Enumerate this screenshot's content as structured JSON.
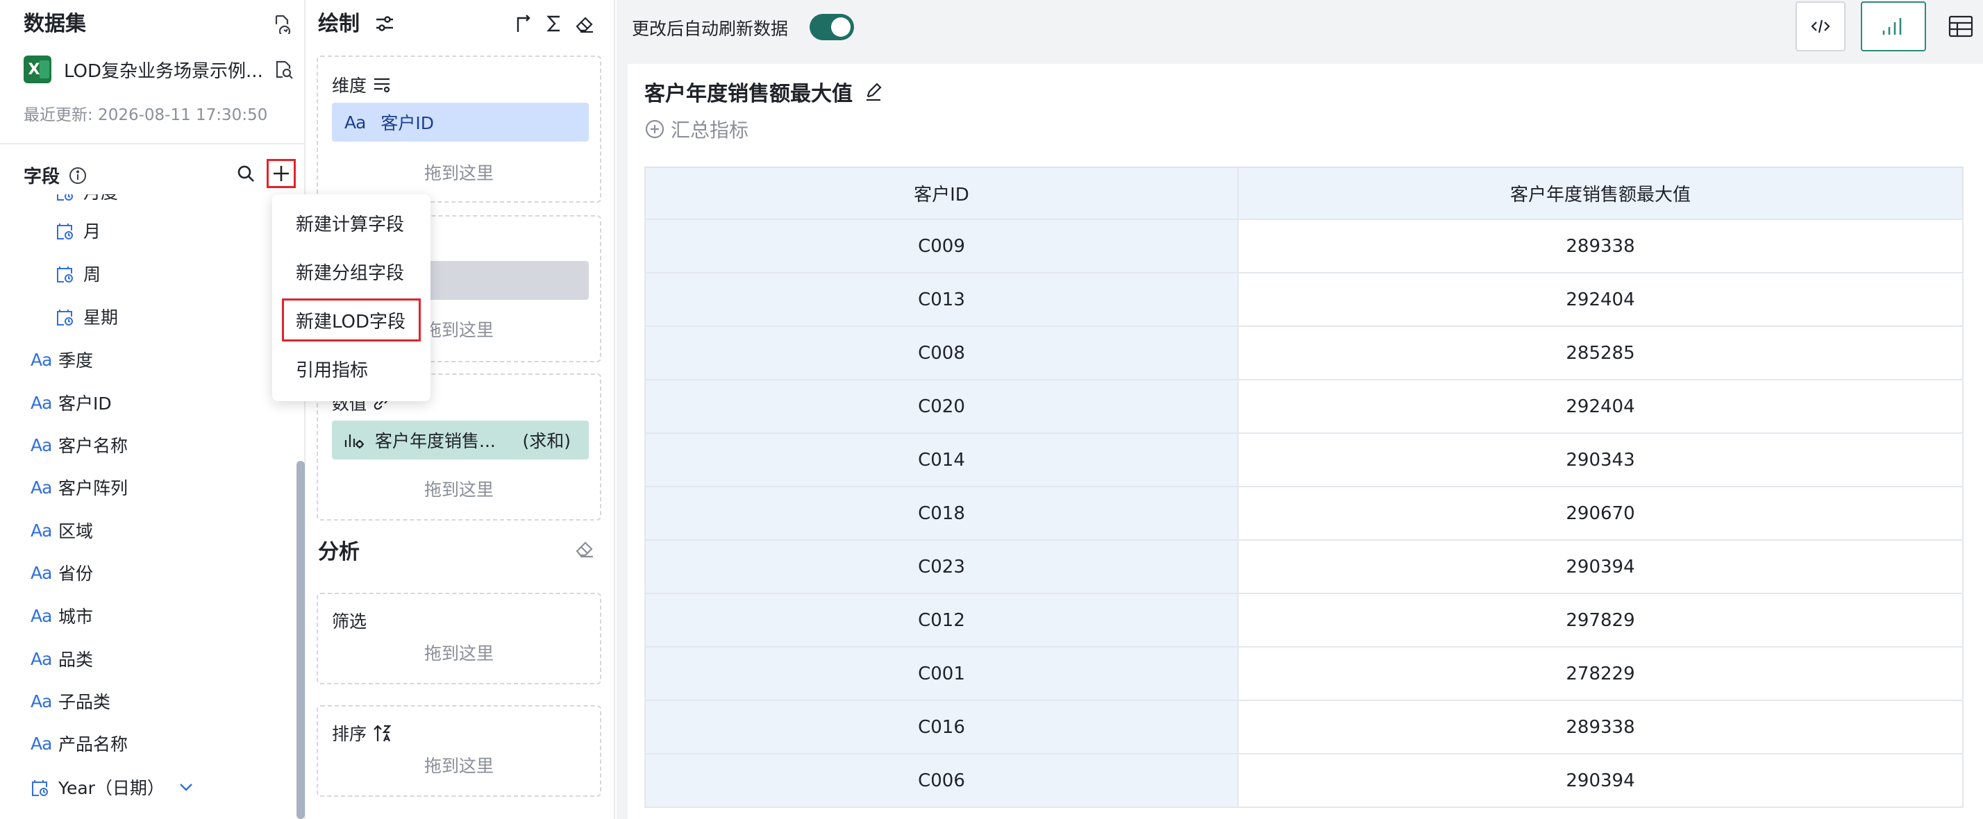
{
  "dataset": {
    "title": "数据集",
    "file_name": "LOD复杂业务场景示例...",
    "last_updated": "最近更新: 2026-08-11 17:30:50"
  },
  "fields": {
    "title": "字段",
    "items": [
      {
        "type": "date",
        "label": "月度",
        "icon": "calendar-icon"
      },
      {
        "type": "date",
        "label": "月",
        "icon": "calendar-icon"
      },
      {
        "type": "date",
        "label": "周",
        "icon": "calendar-icon"
      },
      {
        "type": "date",
        "label": "星期",
        "icon": "calendar-icon"
      },
      {
        "type": "text",
        "label": "季度",
        "icon": "text-type-icon"
      },
      {
        "type": "text",
        "label": "客户ID",
        "icon": "text-type-icon"
      },
      {
        "type": "text",
        "label": "客户名称",
        "icon": "text-type-icon"
      },
      {
        "type": "text",
        "label": "客户阵列",
        "icon": "text-type-icon"
      },
      {
        "type": "text",
        "label": "区域",
        "icon": "text-type-icon"
      },
      {
        "type": "text",
        "label": "省份",
        "icon": "text-type-icon"
      },
      {
        "type": "text",
        "label": "城市",
        "icon": "text-type-icon"
      },
      {
        "type": "text",
        "label": "品类",
        "icon": "text-type-icon"
      },
      {
        "type": "text",
        "label": "子品类",
        "icon": "text-type-icon"
      },
      {
        "type": "text",
        "label": "产品名称",
        "icon": "text-type-icon"
      },
      {
        "type": "date",
        "label": "Year（日期）",
        "icon": "calendar-icon"
      }
    ],
    "type_glyph": "Aa"
  },
  "add_menu": {
    "items": [
      {
        "label": "新建计算字段"
      },
      {
        "label": "新建分组字段"
      },
      {
        "label": "新建LOD字段",
        "highlighted": true
      },
      {
        "label": "引用指标"
      }
    ]
  },
  "draw": {
    "title": "绘制",
    "dimension": {
      "label": "维度",
      "pill": "客户ID",
      "glyph": "Aa",
      "drop_hint": "拖到这里"
    },
    "second_well": {
      "drop_hint": "拖到这里"
    },
    "value": {
      "label": "数值",
      "pill": "客户年度销售...",
      "agg": "(求和)",
      "drop_hint": "拖到这里"
    },
    "analysis_title": "分析",
    "filter": {
      "label": "筛选",
      "drop_hint": "拖到这里"
    },
    "sort": {
      "label": "排序",
      "drop_hint": "拖到这里"
    }
  },
  "main": {
    "auto_refresh_label": "更改后自动刷新数据",
    "auto_refresh_on": true,
    "chart_title": "客户年度销售额最大值",
    "summary_label": "汇总指标",
    "table": {
      "columns": [
        "客户ID",
        "客户年度销售额最大值"
      ],
      "rows": [
        [
          "C009",
          "289338"
        ],
        [
          "C013",
          "292404"
        ],
        [
          "C008",
          "285285"
        ],
        [
          "C020",
          "292404"
        ],
        [
          "C014",
          "290343"
        ],
        [
          "C018",
          "290670"
        ],
        [
          "C023",
          "290394"
        ],
        [
          "C012",
          "297829"
        ],
        [
          "C001",
          "278229"
        ],
        [
          "C016",
          "289338"
        ],
        [
          "C006",
          "290394"
        ]
      ]
    }
  },
  "colors": {
    "accent": "#1f6e64",
    "highlight_border": "#e0242c",
    "dimension_pill": "#cfe0ff",
    "value_pill": "#c4e3dd",
    "table_header_bg": "#edf3fb"
  }
}
